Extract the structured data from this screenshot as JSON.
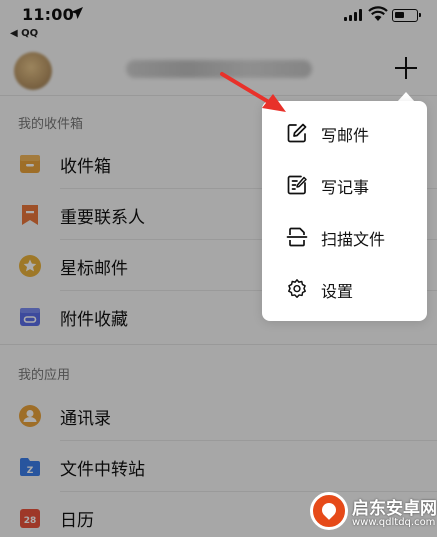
{
  "status_bar": {
    "time": "11:00",
    "back_app": "◀ QQ"
  },
  "header": {
    "add_button_symbol": "+"
  },
  "sections": [
    {
      "title": "我的收件箱",
      "items": [
        {
          "label": "收件箱",
          "icon": "inbox-icon",
          "color": "#e9a23b"
        },
        {
          "label": "重要联系人",
          "icon": "bookmark-icon",
          "color": "#e9773b"
        },
        {
          "label": "星标邮件",
          "icon": "star-icon",
          "color": "#e9b23b"
        },
        {
          "label": "附件收藏",
          "icon": "attachment-icon",
          "color": "#5b6ee8"
        }
      ]
    },
    {
      "title": "我的应用",
      "items": [
        {
          "label": "通讯录",
          "icon": "contacts-icon",
          "color": "#e9a23b"
        },
        {
          "label": "文件中转站",
          "icon": "file-transfer-icon",
          "color": "#3b7ee9"
        },
        {
          "label": "日历",
          "icon": "calendar-icon",
          "color": "#e9533b",
          "badge": "28"
        }
      ]
    }
  ],
  "popup_menu": {
    "items": [
      {
        "label": "写邮件",
        "icon": "compose-icon"
      },
      {
        "label": "写记事",
        "icon": "note-icon"
      },
      {
        "label": "扫描文件",
        "icon": "scan-icon"
      },
      {
        "label": "设置",
        "icon": "gear-icon"
      }
    ]
  },
  "annotation": {
    "arrow_color": "#e8312a"
  },
  "watermark": {
    "name": "启东安卓网",
    "url": "www.qdltdq.com"
  }
}
